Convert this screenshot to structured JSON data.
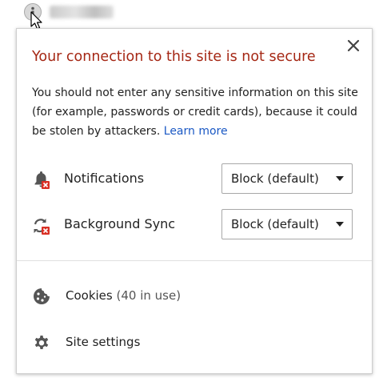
{
  "omnibox": {
    "info_icon": "info-icon"
  },
  "popup": {
    "title": "Your connection to this site is not secure",
    "description": "You should not enter any sensitive information on this site (for example, passwords or credit cards), because it could be stolen by attackers.",
    "learn_more": "Learn more",
    "close_icon": "close-icon",
    "title_color": "#a52714",
    "link_color": "#1a58c4"
  },
  "permissions": [
    {
      "label": "Notifications",
      "value": "Block (default)",
      "icon": "notifications-blocked-icon"
    },
    {
      "label": "Background Sync",
      "value": "Block (default)",
      "icon": "background-sync-blocked-icon"
    }
  ],
  "links": {
    "cookies": {
      "label": "Cookies",
      "count": "(40 in use)",
      "icon": "cookie-icon"
    },
    "site_settings": {
      "label": "Site settings",
      "icon": "gear-icon"
    }
  }
}
